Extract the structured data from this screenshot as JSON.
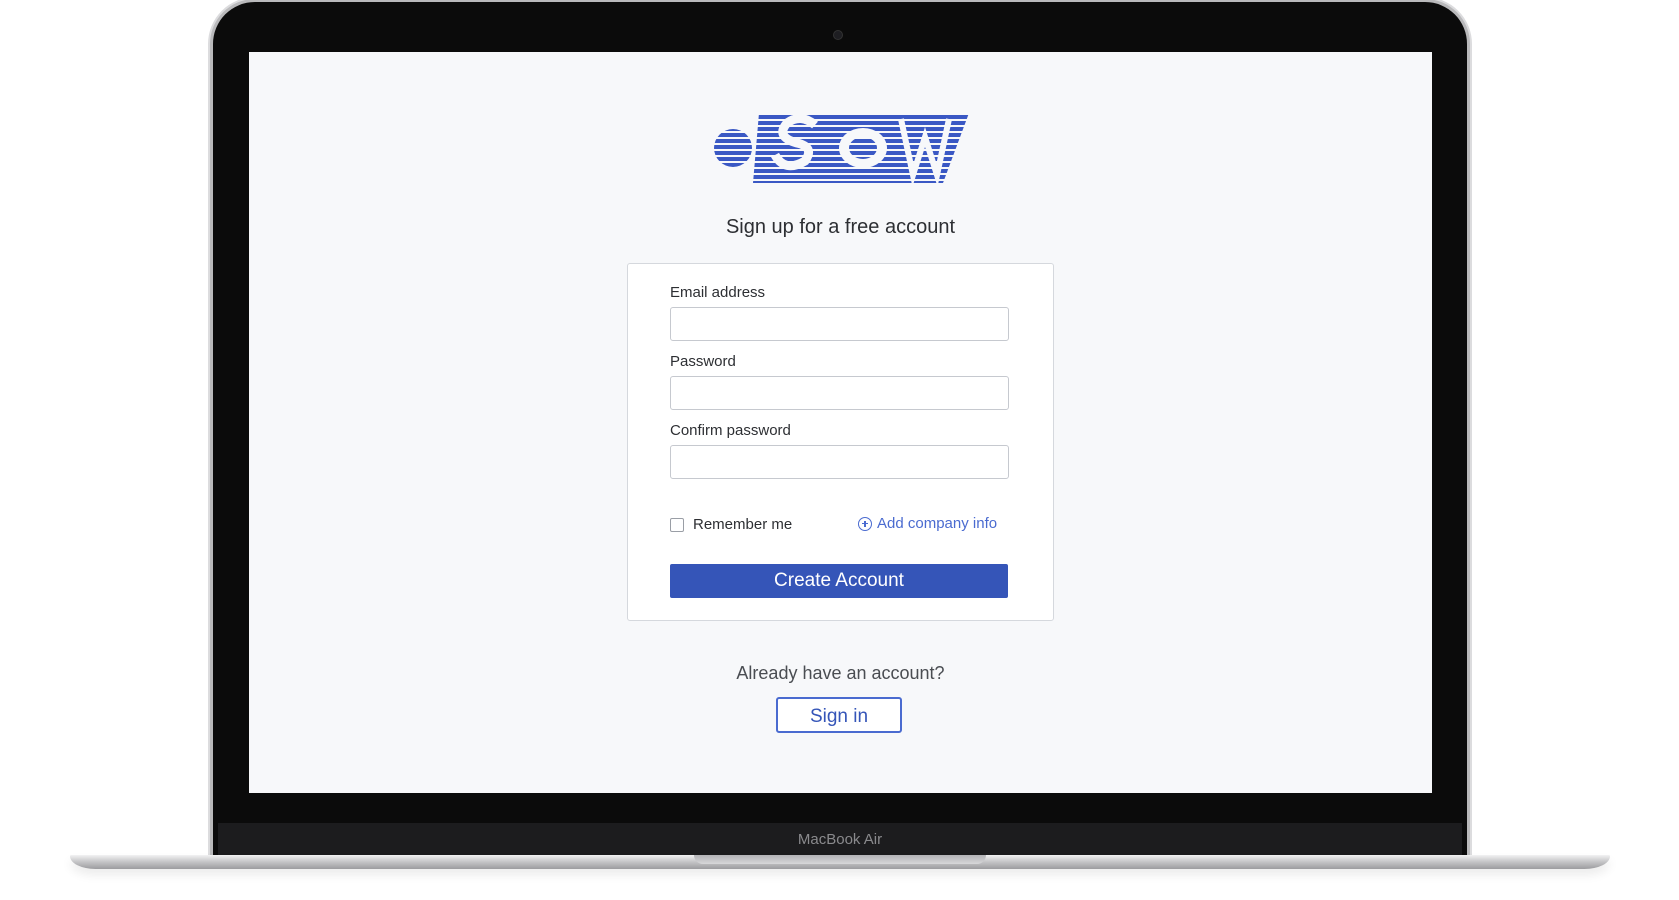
{
  "device": {
    "label": "MacBook Air"
  },
  "logo": {
    "text": "OSDW",
    "color": "#3a58c4"
  },
  "page": {
    "title": "Sign up for a free account"
  },
  "form": {
    "email_label": "Email address",
    "email_value": "",
    "password_label": "Password",
    "password_value": "",
    "confirm_label": "Confirm password",
    "confirm_value": "",
    "remember_label": "Remember me",
    "remember_checked": false,
    "add_company_label": "Add company info",
    "submit_label": "Create Account"
  },
  "footer": {
    "prompt": "Already have an account?",
    "signin_label": "Sign in"
  },
  "colors": {
    "primary": "#3555b8",
    "link": "#4a6bd0",
    "screen_background": "#f7f8fa"
  }
}
